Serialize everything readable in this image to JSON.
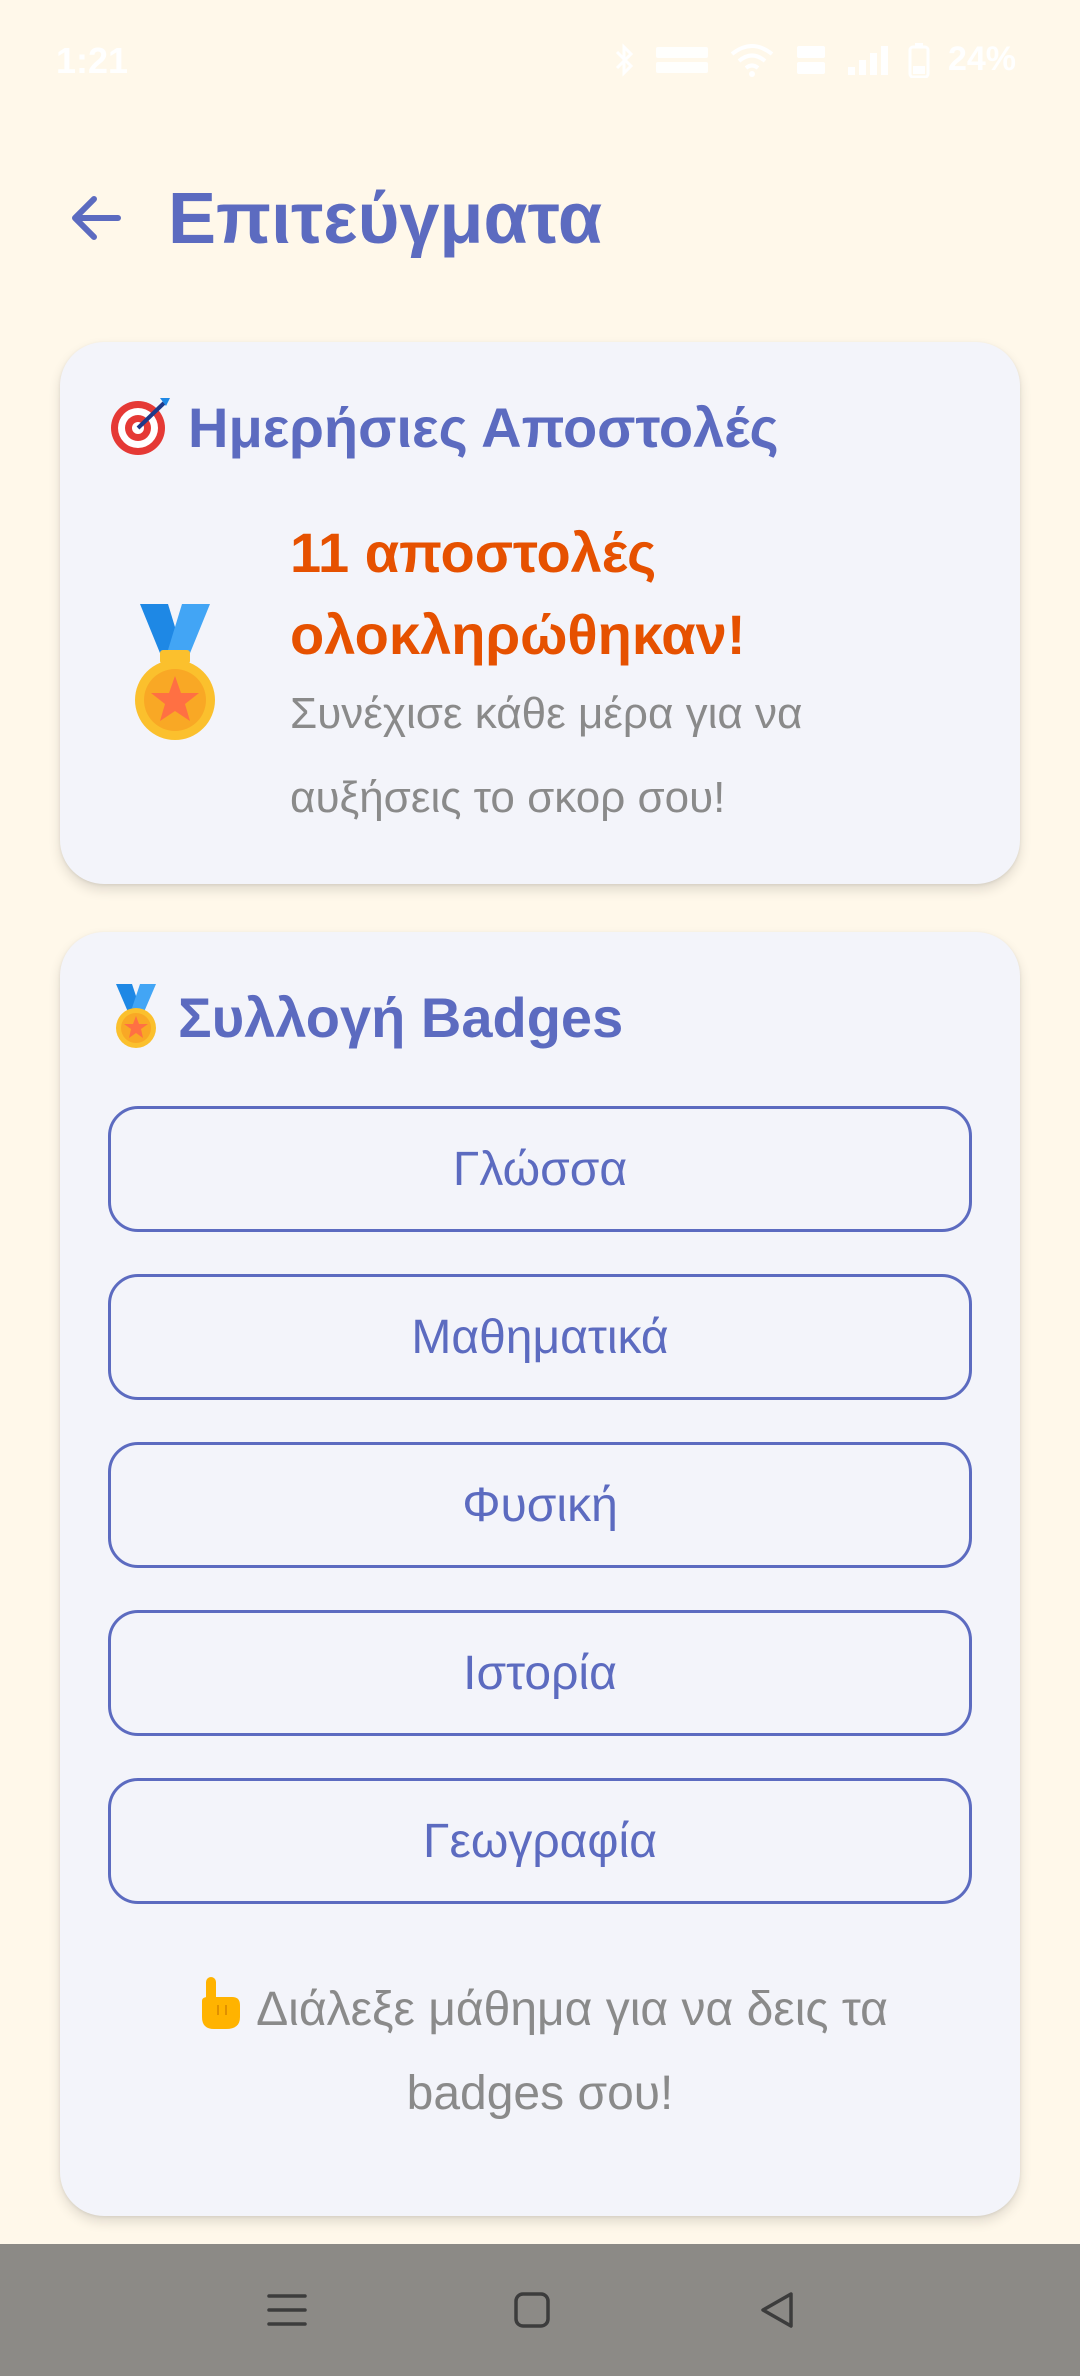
{
  "status_bar": {
    "time": "1:21",
    "battery": "24%",
    "icons": [
      "bluetooth-icon",
      "data-speed-icon",
      "wifi-icon",
      "volte-icon",
      "signal-icon",
      "battery-icon"
    ]
  },
  "header": {
    "back_icon": "arrow-left-icon",
    "title": "Επιτεύγματα"
  },
  "missions": {
    "title_icon": "target-icon",
    "title": "Ημερήσιες Αποστολές",
    "medal_icon": "medal-icon",
    "headline_line1": "11 αποστολές",
    "headline_line2": "ολοκληρώθηκαν!",
    "subtitle": "Συνέχισε κάθε μέρα για να αυξήσεις το σκορ σου!"
  },
  "badges": {
    "title_icon": "medal-icon",
    "title": "Συλλογή Badges",
    "subjects": [
      {
        "label": "Γλώσσα"
      },
      {
        "label": "Μαθηματικά"
      },
      {
        "label": "Φυσική"
      },
      {
        "label": "Ιστορία"
      },
      {
        "label": "Γεωγραφία"
      }
    ],
    "hint_icon": "pointing-hand-icon",
    "hint": "Διάλεξε μάθημα για να δεις τα badges σου!"
  },
  "nav": {
    "items": [
      "menu-icon",
      "home-icon",
      "back-icon"
    ]
  },
  "colors": {
    "background": "#FFF8EA",
    "primary": "#5C6BC0",
    "accent": "#E65100",
    "muted_text": "#8A8A8A",
    "card": "#F3F4FA",
    "nav_bar": "#8C8A86"
  }
}
